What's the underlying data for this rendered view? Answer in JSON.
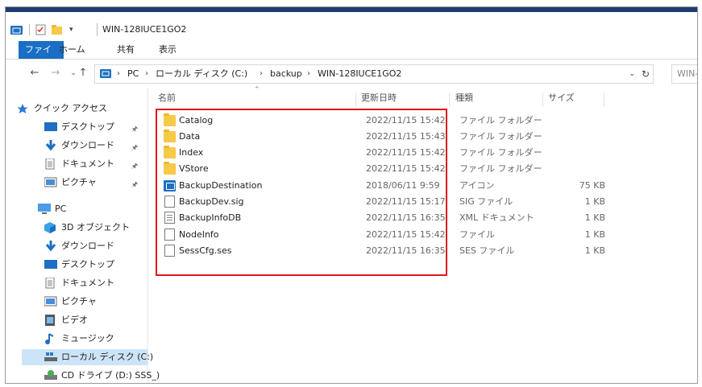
{
  "window": {
    "title": "WIN-128IUCE1GO2"
  },
  "ribbon": {
    "tabs": [
      {
        "label": "ファイル",
        "active": true
      },
      {
        "label": "ホーム",
        "active": false
      },
      {
        "label": "共有",
        "active": false
      },
      {
        "label": "表示",
        "active": false
      }
    ]
  },
  "address": {
    "crumbs": [
      "PC",
      "ローカル ディスク (C:)",
      "backup",
      "WIN-128IUCE1GO2"
    ],
    "search_text": "WIN-"
  },
  "nav": {
    "quick_access": "クイック アクセス",
    "quick_items": [
      "デスクトップ",
      "ダウンロード",
      "ドキュメント",
      "ピクチャ"
    ],
    "pc": "PC",
    "pc_items": [
      "3D オブジェクト",
      "ダウンロード",
      "デスクトップ",
      "ドキュメント",
      "ピクチャ",
      "ビデオ",
      "ミュージック",
      "ローカル ディスク (C:)",
      "CD ドライブ (D:) SSS_)"
    ]
  },
  "columns": {
    "name": "名前",
    "date": "更新日時",
    "type": "種類",
    "size": "サイズ"
  },
  "files": [
    {
      "name": "Catalog",
      "date": "2022/11/15 15:42",
      "type": "ファイル フォルダー",
      "size": "",
      "icon": "folder-icon"
    },
    {
      "name": "Data",
      "date": "2022/11/15 15:43",
      "type": "ファイル フォルダー",
      "size": "",
      "icon": "folder-icon"
    },
    {
      "name": "Index",
      "date": "2022/11/15 15:42",
      "type": "ファイル フォルダー",
      "size": "",
      "icon": "folder-icon"
    },
    {
      "name": "VStore",
      "date": "2022/11/15 15:42",
      "type": "ファイル フォルダー",
      "size": "",
      "icon": "folder-icon"
    },
    {
      "name": "BackupDestination",
      "date": "2018/06/11 9:59",
      "type": "アイコン",
      "size": "75 KB",
      "icon": "backup-destination-icon"
    },
    {
      "name": "BackupDev.sig",
      "date": "2022/11/15 15:17",
      "type": "SIG ファイル",
      "size": "1 KB",
      "icon": "file-icon"
    },
    {
      "name": "BackupInfoDB",
      "date": "2022/11/15 16:35",
      "type": "XML ドキュメント",
      "size": "1 KB",
      "icon": "xml-document-icon"
    },
    {
      "name": "NodeInfo",
      "date": "2022/11/15 15:42",
      "type": "ファイル",
      "size": "1 KB",
      "icon": "file-icon"
    },
    {
      "name": "SessCfg.ses",
      "date": "2022/11/15 16:35",
      "type": "SES ファイル",
      "size": "1 KB",
      "icon": "file-icon"
    }
  ],
  "colors": {
    "highlight_box": "#e0161c",
    "ribbon_active": "#1a6fc4",
    "folder": "#f7c948",
    "selection": "#cce4f7"
  }
}
